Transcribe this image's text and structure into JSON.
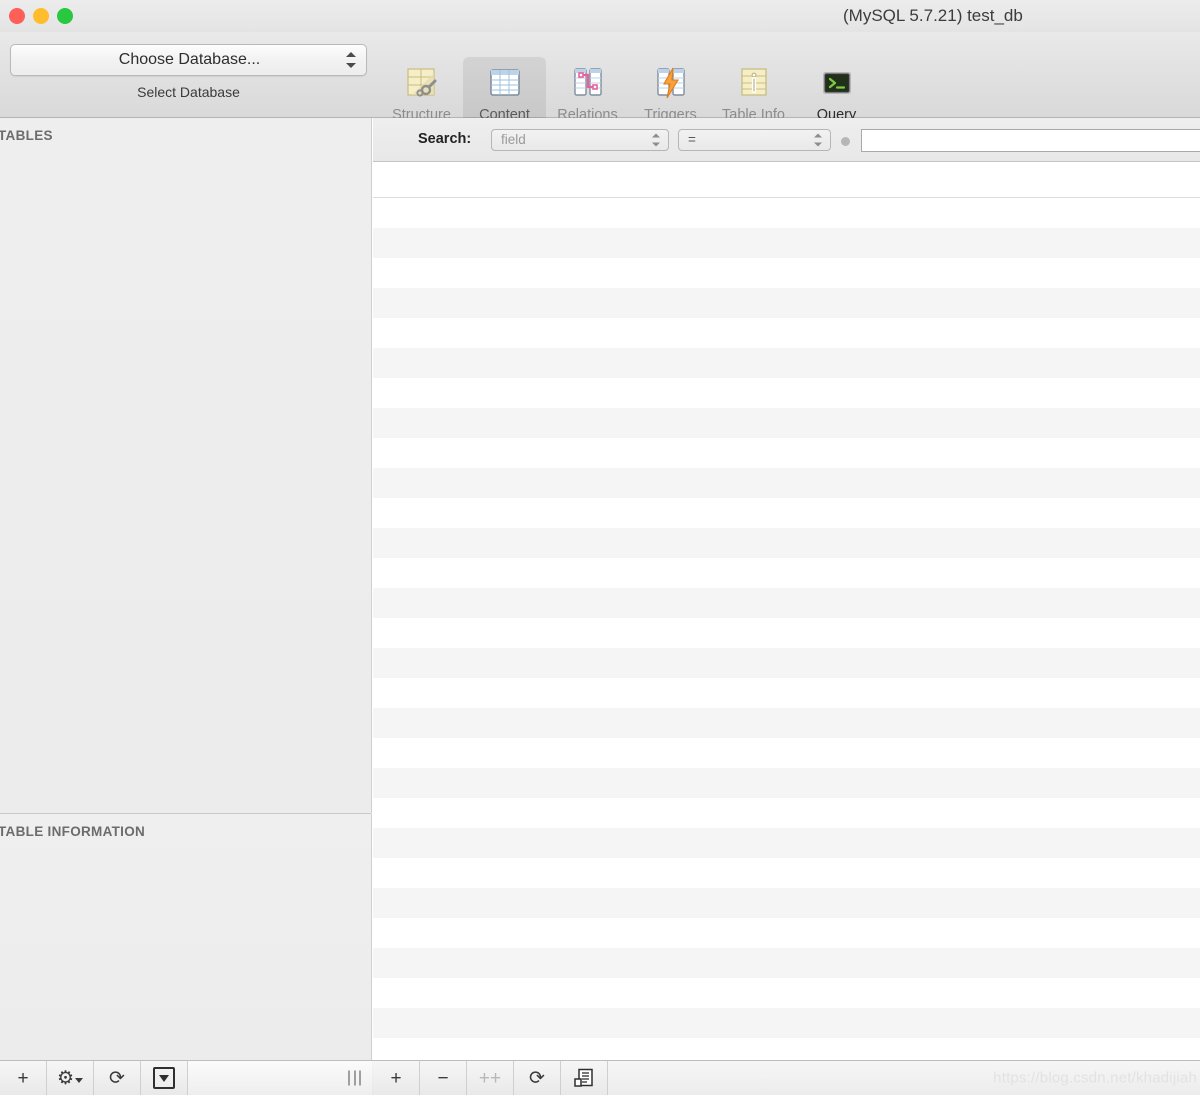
{
  "window": {
    "title": "(MySQL 5.7.21) test_db",
    "traffic_lights": [
      {
        "name": "close",
        "color": "#ff5f57"
      },
      {
        "name": "minimize",
        "color": "#ffbd2e"
      },
      {
        "name": "maximize",
        "color": "#28c840"
      }
    ]
  },
  "toolbar": {
    "database_chooser": {
      "value": "Choose Database...",
      "caption": "Select Database"
    },
    "tabs": [
      {
        "label": "Structure",
        "icon": "structure-icon",
        "selected": false
      },
      {
        "label": "Content",
        "icon": "content-icon",
        "selected": true
      },
      {
        "label": "Relations",
        "icon": "relations-icon",
        "selected": false
      },
      {
        "label": "Triggers",
        "icon": "triggers-icon",
        "selected": false
      },
      {
        "label": "Table Info",
        "icon": "table-info-icon",
        "selected": false
      },
      {
        "label": "Query",
        "icon": "query-icon",
        "selected": false
      }
    ]
  },
  "sidebar": {
    "tables_header": "TABLES",
    "tables_items": [],
    "table_information_header": "TABLE INFORMATION",
    "table_information_items": []
  },
  "content": {
    "search": {
      "label": "Search:",
      "field_value": "field",
      "operator_value": "=",
      "text_value": "",
      "text_placeholder": ""
    },
    "grid": {
      "columns": [],
      "rows": [],
      "row_count": 29
    }
  },
  "bottom_bar": {
    "left_buttons": [
      {
        "name": "add-table-button",
        "glyph": "+",
        "enabled": true
      },
      {
        "name": "table-actions-button",
        "glyph": "⚙",
        "enabled": true,
        "has_menu_arrow": true
      },
      {
        "name": "refresh-tables-button",
        "glyph": "↻",
        "enabled": true
      },
      {
        "name": "filter-tables-button",
        "glyph": "▼",
        "enabled": true,
        "boxed": true
      }
    ],
    "right_buttons": [
      {
        "name": "add-row-button",
        "glyph": "+",
        "enabled": true
      },
      {
        "name": "remove-row-button",
        "glyph": "−",
        "enabled": true
      },
      {
        "name": "duplicate-row-button",
        "glyph": "⸭",
        "enabled": false
      },
      {
        "name": "refresh-content-button",
        "glyph": "↻",
        "enabled": true
      },
      {
        "name": "pagination-button",
        "glyph": "☰",
        "enabled": true
      }
    ],
    "watermark": "https://blog.csdn.net/khadijiah"
  },
  "colors": {
    "toolbar_bg": "#e4e4e4",
    "sidebar_bg": "#ededed",
    "content_bg": "#ffffff",
    "row_alt_bg": "#f5f5f5",
    "selected_tab_bg": "rgba(0,0,0,0.075)"
  }
}
